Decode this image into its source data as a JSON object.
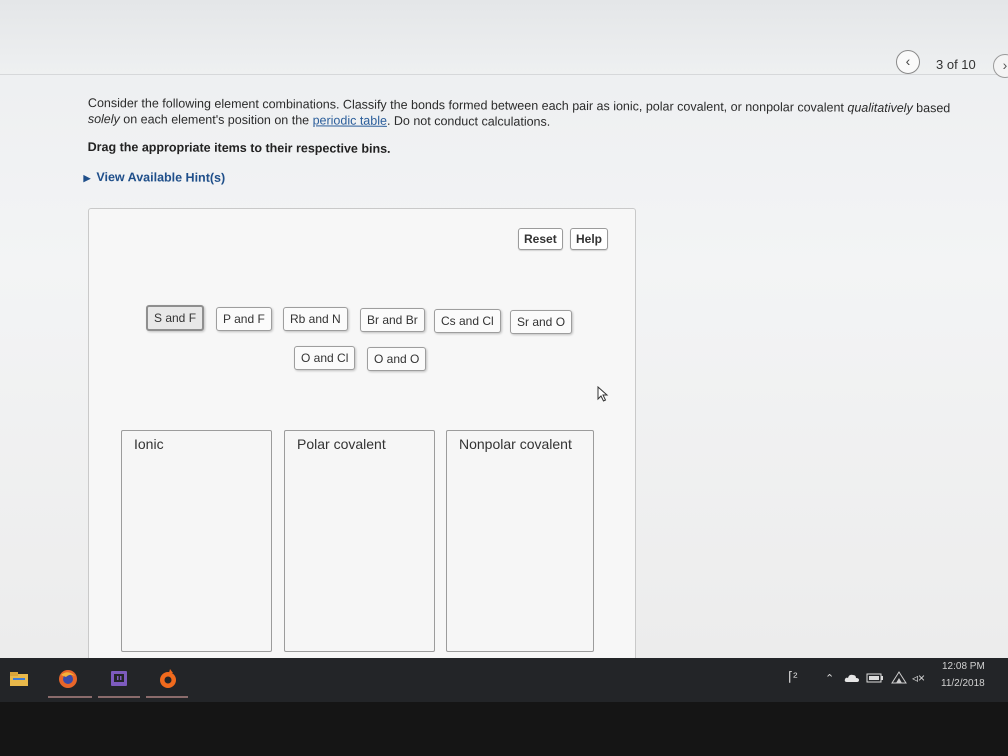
{
  "nav": {
    "prev_icon": "chevron-left-icon",
    "counter": "3 of 10",
    "next_icon": "chevron-right-icon"
  },
  "question": {
    "part1": "Consider the following element combinations. Classify the bonds formed between each pair as ionic, polar covalent, or nonpolar covalent ",
    "emph1": "qualitatively",
    "part2": " based ",
    "emph2": "solely",
    "part3": " on each element's position on the ",
    "link": "periodic table",
    "part4": ". Do not conduct calculations."
  },
  "instruction": "Drag the appropriate items to their respective bins.",
  "hint": "View Available Hint(s)",
  "buttons": {
    "reset": "Reset",
    "help": "Help"
  },
  "items": [
    {
      "label": "S and F",
      "selected": true
    },
    {
      "label": "P and F"
    },
    {
      "label": "Rb and N"
    },
    {
      "label": "Br and Br"
    },
    {
      "label": "Cs and Cl"
    },
    {
      "label": "Sr and O"
    },
    {
      "label": "O and Cl"
    },
    {
      "label": "O and O"
    }
  ],
  "bins": [
    {
      "label": "Ionic"
    },
    {
      "label": "Polar covalent"
    },
    {
      "label": "Nonpolar covalent"
    }
  ],
  "taskbar": {
    "icons": [
      "file-explorer-icon",
      "firefox-icon",
      "twitch-icon",
      "origin-icon"
    ],
    "tray_icons": [
      "people-icon",
      "chevron-up-icon",
      "onedrive-icon",
      "battery-icon",
      "wifi-icon",
      "volume-muted-icon"
    ],
    "time": "12:08 PM",
    "date": "11/2/2018"
  }
}
